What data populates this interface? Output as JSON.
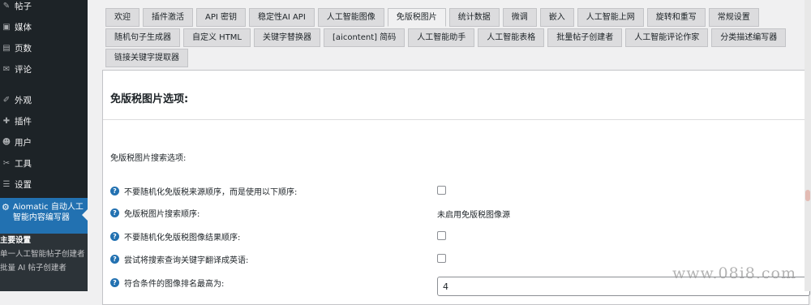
{
  "sidebar": {
    "items": [
      {
        "label": "帖子",
        "icon": "pushpin-icon"
      },
      {
        "label": "媒体",
        "icon": "media-icon"
      },
      {
        "label": "页数",
        "icon": "page-icon"
      },
      {
        "label": "评论",
        "icon": "comment-icon"
      },
      {
        "label": "外观",
        "icon": "brush-icon"
      },
      {
        "label": "插件",
        "icon": "plugin-icon"
      },
      {
        "label": "用户",
        "icon": "user-icon"
      },
      {
        "label": "工具",
        "icon": "wrench-icon"
      },
      {
        "label": "设置",
        "icon": "settings-icon"
      }
    ],
    "active": {
      "label": "Aiomatic 自动人工智能内容编写器",
      "icon": "robot-icon"
    },
    "submenu": [
      "主要设置",
      "单一人工智能帖子创建者",
      "批量 AI 帖子创建者"
    ]
  },
  "tabs": {
    "row1": [
      "欢迎",
      "插件激活",
      "API 密钥",
      "稳定性AI API",
      "人工智能图像",
      "免版税图片",
      "统计数据",
      "微调",
      "嵌入",
      "人工智能上网",
      "旋转和重写",
      "常规设置"
    ],
    "row2": [
      "随机句子生成器",
      "自定义 HTML",
      "关键字替换器",
      "[aicontent] 简码",
      "人工智能助手",
      "人工智能表格",
      "批量帖子创建者",
      "人工智能评论作家",
      "分类描述编写器"
    ],
    "row3": [
      "链接关键字提取器"
    ],
    "active": "免版税图片"
  },
  "panel": {
    "title": "免版税图片选项:",
    "section": "免版税图片搜索选项:",
    "rows": [
      {
        "label": "不要随机化免版税来源顺序，而是使用以下顺序:",
        "control": "checkbox"
      },
      {
        "label": "免版税图片搜索顺序:",
        "control": "text",
        "value": "未启用免版税图像源"
      },
      {
        "label": "不要随机化免版税图像结果顺序:",
        "control": "checkbox"
      },
      {
        "label": "尝试将搜索查询关键字翻译成英语:",
        "control": "checkbox"
      },
      {
        "label": "符合条件的图像排名最高为:",
        "control": "input",
        "value": "4"
      }
    ]
  },
  "watermark": "www.08i8.com"
}
